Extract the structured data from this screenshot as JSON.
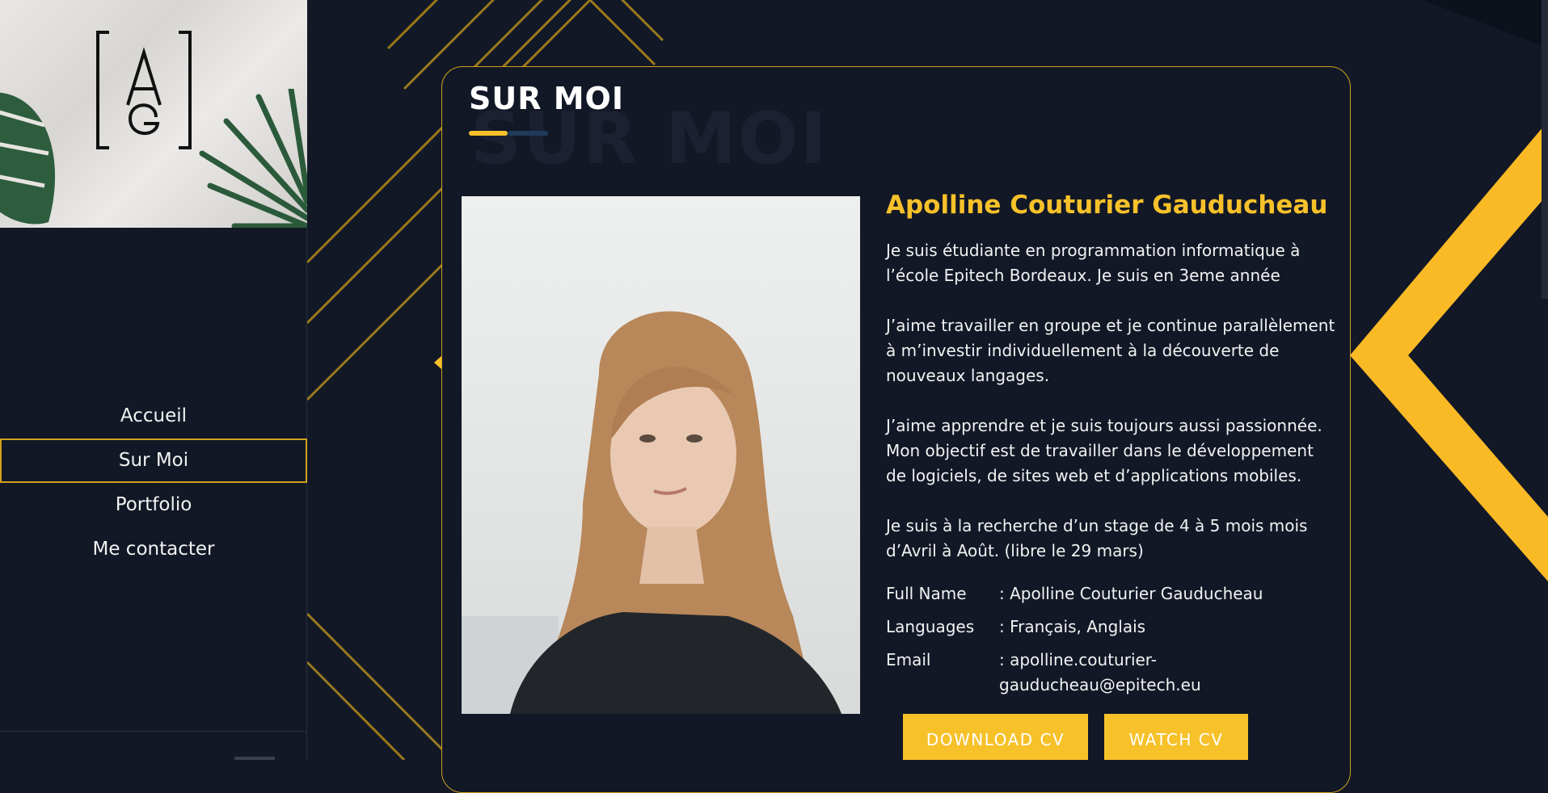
{
  "colors": {
    "background": "#121826",
    "accent": "#f7c12a",
    "accent_border": "#d2a21e",
    "text": "#f2f2f2"
  },
  "logo": {
    "alt": "AG monogram logo"
  },
  "nav": {
    "items": [
      {
        "label": "Accueil",
        "active": false
      },
      {
        "label": "Sur Moi",
        "active": true
      },
      {
        "label": "Portfolio",
        "active": false
      },
      {
        "label": "Me contacter",
        "active": false
      }
    ]
  },
  "section": {
    "title": "SUR MOI",
    "ghost_title": "SUR MOI"
  },
  "profile": {
    "name": "Apolline Couturier Gauducheau",
    "bio": [
      "Je suis étudiante en programmation informatique à l’école Epitech Bordeaux. Je suis en 3eme année",
      "J’aime travailler en groupe et je continue parallèlement à m’investir individuellement à la découverte de nouveaux langages.",
      "J’aime apprendre et je suis toujours aussi passionnée. Mon objectif est de travailler dans le développement de logiciels, de sites web et d’applications mobiles.",
      "Je suis à la recherche d’un stage de 4 à 5 mois mois d’Avril à Août. (libre le 29 mars)"
    ],
    "info": [
      {
        "label": "Full Name",
        "value": ": Apolline Couturier Gauducheau"
      },
      {
        "label": "Languages",
        "value": ": Français, Anglais"
      },
      {
        "label": "Email",
        "value": ": apolline.couturier-gauducheau@epitech.eu"
      }
    ]
  },
  "buttons": {
    "download": "DOWNLOAD CV",
    "watch": "WATCH CV"
  }
}
